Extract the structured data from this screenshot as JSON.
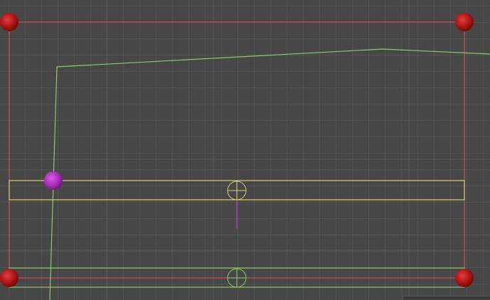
{
  "scene": {
    "background_color": "#474747",
    "grid_color": "#545454",
    "major_grid_color": "#5c5c5c"
  },
  "colors": {
    "selection_rect": "#e05050",
    "yellow_collider": "#d8d070",
    "green_collider": "#88cc66",
    "green_path": "#88cc66",
    "pivot_handle_yellow": "#d8d070",
    "pivot_handle_green": "#88cc66",
    "pivot_stem": "#c040c0",
    "corner_handle": "#b01818",
    "selected_point": "#b030c0"
  },
  "icons": {
    "corner_handles": "red-sphere-handle-icon",
    "selected_point": "magenta-sphere-handle-icon",
    "pivot": "crosshair-circle-icon"
  }
}
